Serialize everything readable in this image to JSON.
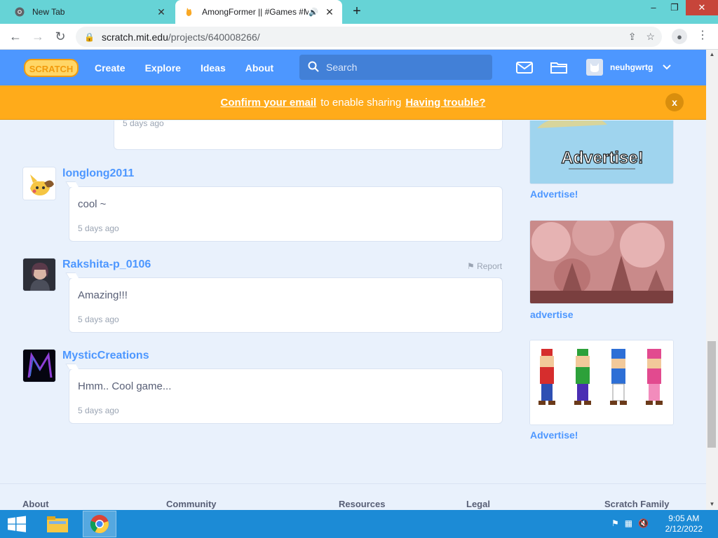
{
  "browser": {
    "tabs": [
      {
        "title": "New Tab",
        "active": false
      },
      {
        "title": "AmongFormer || #Games #M",
        "active": true
      }
    ],
    "new_tab_label": "+",
    "url_host": "scratch.mit.edu",
    "url_path": "/projects/640008266/",
    "window_controls": {
      "minimize": "–",
      "restore": "❐",
      "close": "✕"
    }
  },
  "scratch_nav": {
    "logo_text": "SCRATCH",
    "items": [
      "Create",
      "Explore",
      "Ideas",
      "About"
    ],
    "search_placeholder": "Search",
    "username": "neuhgwrtg"
  },
  "banner": {
    "link1": "Confirm your email",
    "middle": "to enable sharing",
    "link2": "Having trouble?",
    "close_label": "x"
  },
  "comments": [
    {
      "username": "",
      "text": "",
      "time": "5 days ago"
    },
    {
      "username": "longlong2011",
      "text": "cool ~",
      "time": "5 days ago"
    },
    {
      "username": "Rakshita-p_0106",
      "text": "Amazing!!!",
      "time": "5 days ago",
      "report": "Report"
    },
    {
      "username": "MysticCreations",
      "text": "Hmm.. Cool game...",
      "time": "5 days ago"
    }
  ],
  "studios": [
    {
      "title": "Advertise!",
      "thumb_text": "Advertise!"
    },
    {
      "title": "advertise"
    },
    {
      "title": "Advertise!"
    }
  ],
  "footer": {
    "headings": [
      "About",
      "Community",
      "Resources",
      "Legal",
      "Scratch Family"
    ]
  },
  "taskbar": {
    "time": "9:05 AM",
    "date": "2/12/2022"
  },
  "colors": {
    "scratch_blue": "#4d97ff",
    "banner_orange": "#ffab1a",
    "tabstrip": "#66d3d6",
    "taskbar": "#1c8bd6"
  }
}
